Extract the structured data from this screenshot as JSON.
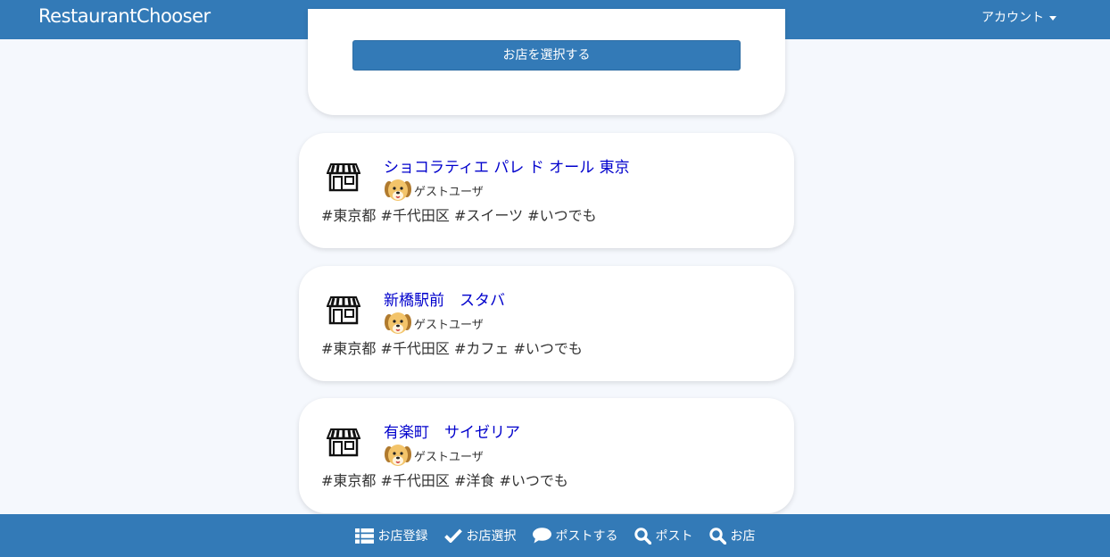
{
  "header": {
    "brand": "RestaurantChooser",
    "account_label": "アカウント"
  },
  "select_card": {
    "button_label": "お店を選択する"
  },
  "shops": [
    {
      "name": "ショコラティエ パレ ド オール 東京",
      "user": "ゲストユーザ",
      "tags": "#東京都 #千代田区 #スイーツ #いつでも"
    },
    {
      "name": "新橋駅前　スタバ",
      "user": "ゲストユーザ",
      "tags": "#東京都 #千代田区 #カフェ #いつでも"
    },
    {
      "name": "有楽町　サイゼリア",
      "user": "ゲストユーザ",
      "tags": "#東京都 #千代田区 #洋食 #いつでも"
    }
  ],
  "footer_nav": [
    {
      "label": "お店登録",
      "icon": "list-icon"
    },
    {
      "label": "お店選択",
      "icon": "check-icon"
    },
    {
      "label": "ポストする",
      "icon": "comment-icon"
    },
    {
      "label": "ポスト",
      "icon": "search-icon"
    },
    {
      "label": "お店",
      "icon": "search-icon"
    }
  ],
  "colors": {
    "primary": "#337ab7",
    "link": "#0000cc",
    "background": "#f5f8fd"
  }
}
